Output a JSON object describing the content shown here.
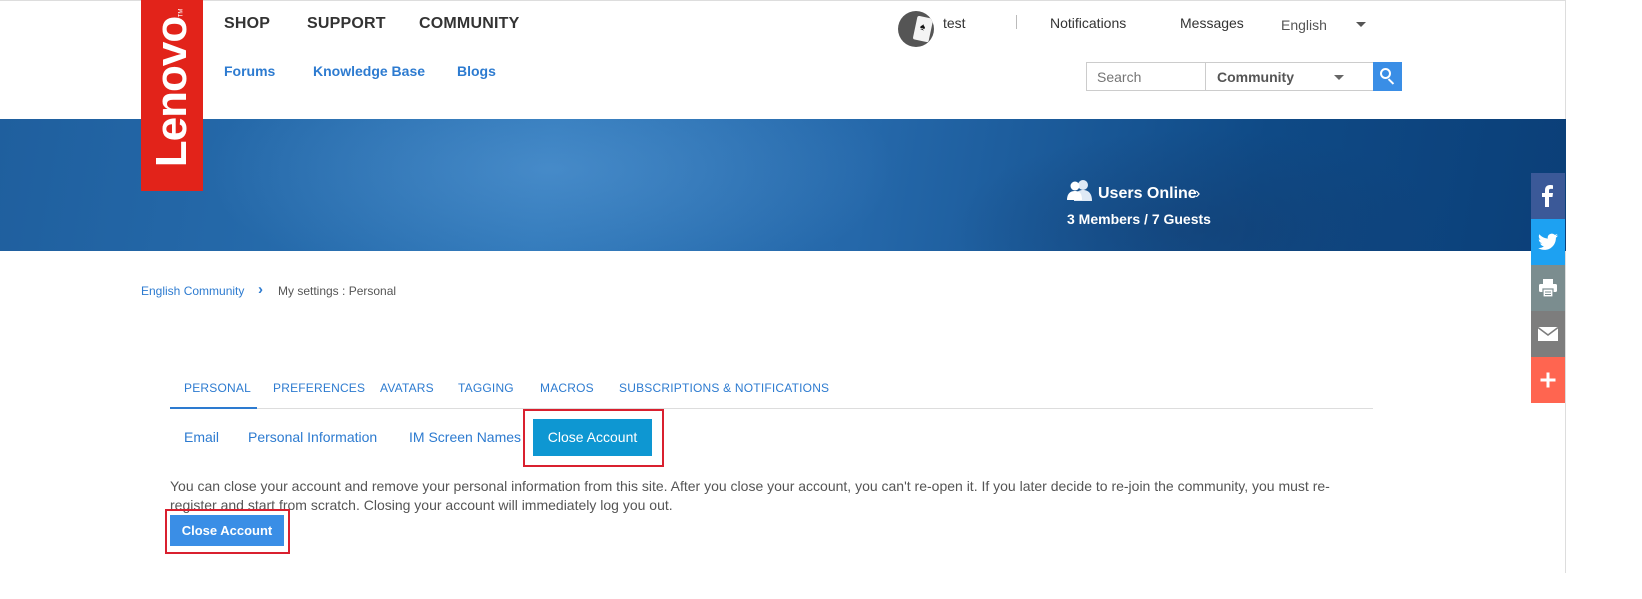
{
  "brand": {
    "logo_text": "Lenovo",
    "tm": "TM",
    "color": "#e2231a"
  },
  "topnav": [
    "SHOP",
    "SUPPORT",
    "COMMUNITY"
  ],
  "subnav": [
    "Forums",
    "Knowledge Base",
    "Blogs"
  ],
  "user": {
    "name": "test",
    "avatar_icon": "playing-card-avatar"
  },
  "header_links": {
    "notifications": "Notifications",
    "messages": "Messages",
    "language": "English"
  },
  "search": {
    "placeholder": "Search",
    "scope": "Community",
    "icon": "search-icon"
  },
  "banner": {
    "users_online": "Users Online",
    "counts": "3 Members / 7 Guests",
    "icon": "users-icon"
  },
  "share": [
    {
      "icon": "facebook-icon",
      "color": "#3b5998"
    },
    {
      "icon": "twitter-icon",
      "color": "#1da1f2"
    },
    {
      "icon": "print-icon",
      "color": "#7b8d8f"
    },
    {
      "icon": "email-icon",
      "color": "#7d7d7d"
    },
    {
      "icon": "plus-icon",
      "color": "#ff6550"
    }
  ],
  "breadcrumb": {
    "root": "English Community",
    "current": "My settings : Personal"
  },
  "tabs": [
    "PERSONAL",
    "PREFERENCES",
    "AVATARS",
    "TAGGING",
    "MACROS",
    "SUBSCRIPTIONS & NOTIFICATIONS"
  ],
  "active_tab": "PERSONAL",
  "subtabs": [
    "Email",
    "Personal Information",
    "IM Screen Names",
    "Close Account"
  ],
  "active_subtab": "Close Account",
  "content": {
    "description": "You can close your account and remove your personal information from this site. After you close your account, you can't re-open it. If you later decide to re-join the community, you must re-register and start from scratch. Closing your account will immediately log you out.",
    "close_button": "Close Account"
  },
  "colors": {
    "accent": "#2d7bd0",
    "active_subtab": "#0e97d2",
    "button": "#3a8ee6",
    "highlight": "#d9202f"
  }
}
